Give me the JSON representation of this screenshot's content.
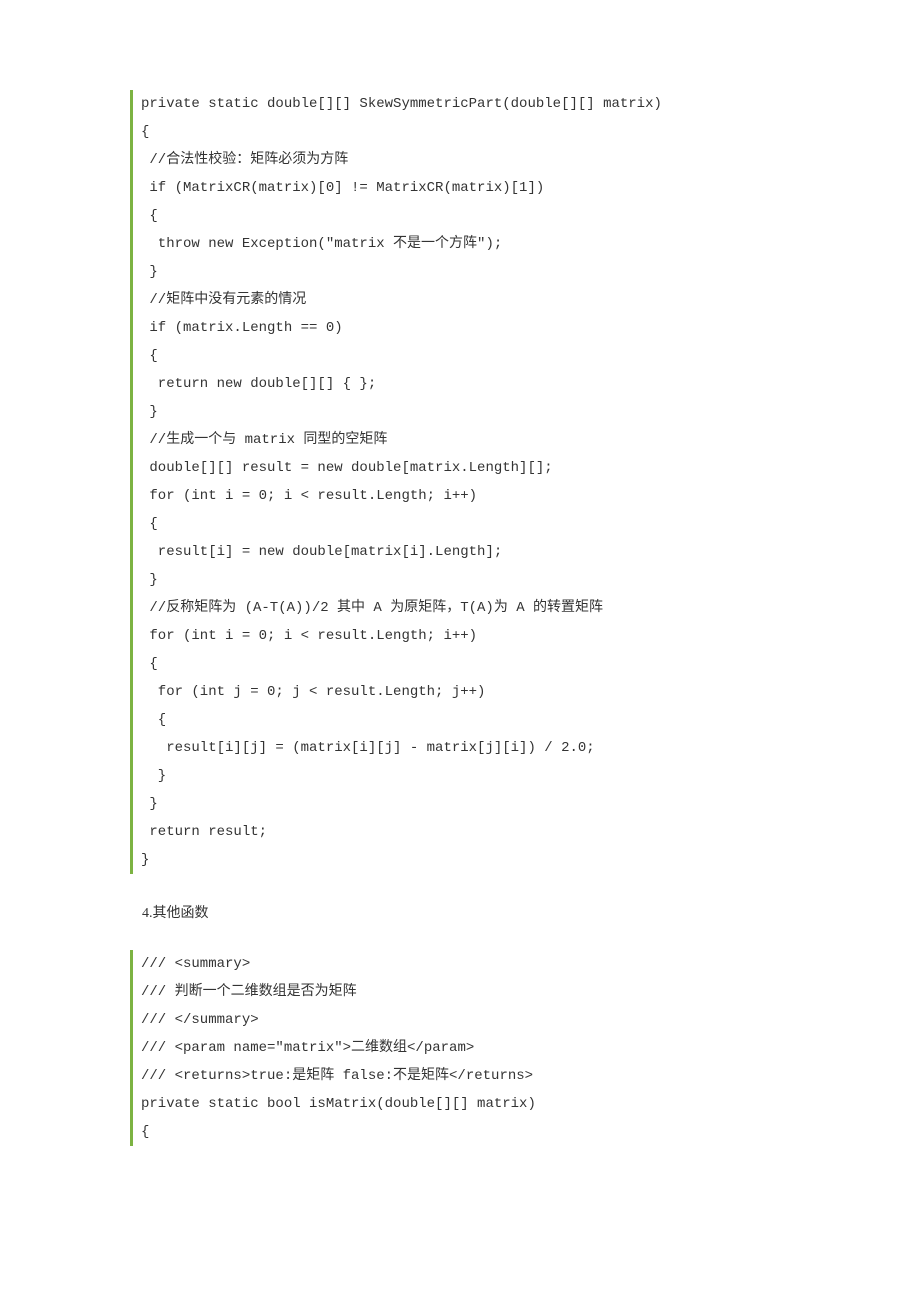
{
  "codeBlock1": {
    "lines": [
      "private static double[][] SkewSymmetricPart(double[][] matrix)",
      "{",
      " //合法性校验：矩阵必须为方阵",
      " if (MatrixCR(matrix)[0] != MatrixCR(matrix)[1])",
      " {",
      "  throw new Exception(\"matrix 不是一个方阵\");",
      " }",
      " //矩阵中没有元素的情况",
      " if (matrix.Length == 0)",
      " {",
      "  return new double[][] { };",
      " }",
      " //生成一个与 matrix 同型的空矩阵",
      " double[][] result = new double[matrix.Length][];",
      " for (int i = 0; i < result.Length; i++)",
      " {",
      "  result[i] = new double[matrix[i].Length];",
      " }",
      " //反称矩阵为 (A-T(A))/2 其中 A 为原矩阵，T(A)为 A 的转置矩阵",
      " for (int i = 0; i < result.Length; i++)",
      " {",
      "  for (int j = 0; j < result.Length; j++)",
      "  {",
      "   result[i][j] = (matrix[i][j] - matrix[j][i]) / 2.0;",
      "  }",
      " }",
      " return result;",
      "}"
    ]
  },
  "sectionHeading": "4.其他函数",
  "codeBlock2": {
    "lines": [
      "/// <summary>",
      "/// 判断一个二维数组是否为矩阵",
      "/// </summary>",
      "/// <param name=\"matrix\">二维数组</param>",
      "/// <returns>true:是矩阵 false:不是矩阵</returns>",
      "private static bool isMatrix(double[][] matrix)",
      "{"
    ]
  }
}
